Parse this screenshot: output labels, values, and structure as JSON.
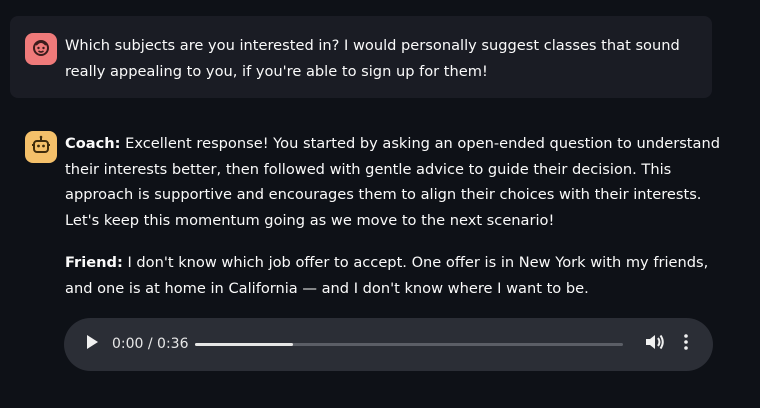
{
  "messages": {
    "user": {
      "text": "Which subjects are you interested in? I would personally suggest classes that sound really appealing to you, if you're able to sign up for them!",
      "avatar_icon": "face-icon",
      "avatar_color": "#ef7a7a"
    },
    "coach": {
      "label": "Coach:",
      "text": " Excellent response! You started by asking an open-ended question to understand their interests better, then followed with gentle advice to guide their decision. This approach is supportive and encourages them to align their choices with their interests. Let's keep this momentum going as we move to the next scenario!",
      "avatar_icon": "robot-icon",
      "avatar_color": "#f4c06a"
    },
    "friend": {
      "label": "Friend:",
      "text": " I don't know which job offer to accept. One offer is in New York with my friends, and one is at home in California — and I don't know where I want to be."
    }
  },
  "audio_player": {
    "time": "0:00 / 0:36",
    "progress": 0.23,
    "play_icon": "play-icon",
    "volume_icon": "volume-icon",
    "menu_icon": "more-vertical-icon"
  }
}
